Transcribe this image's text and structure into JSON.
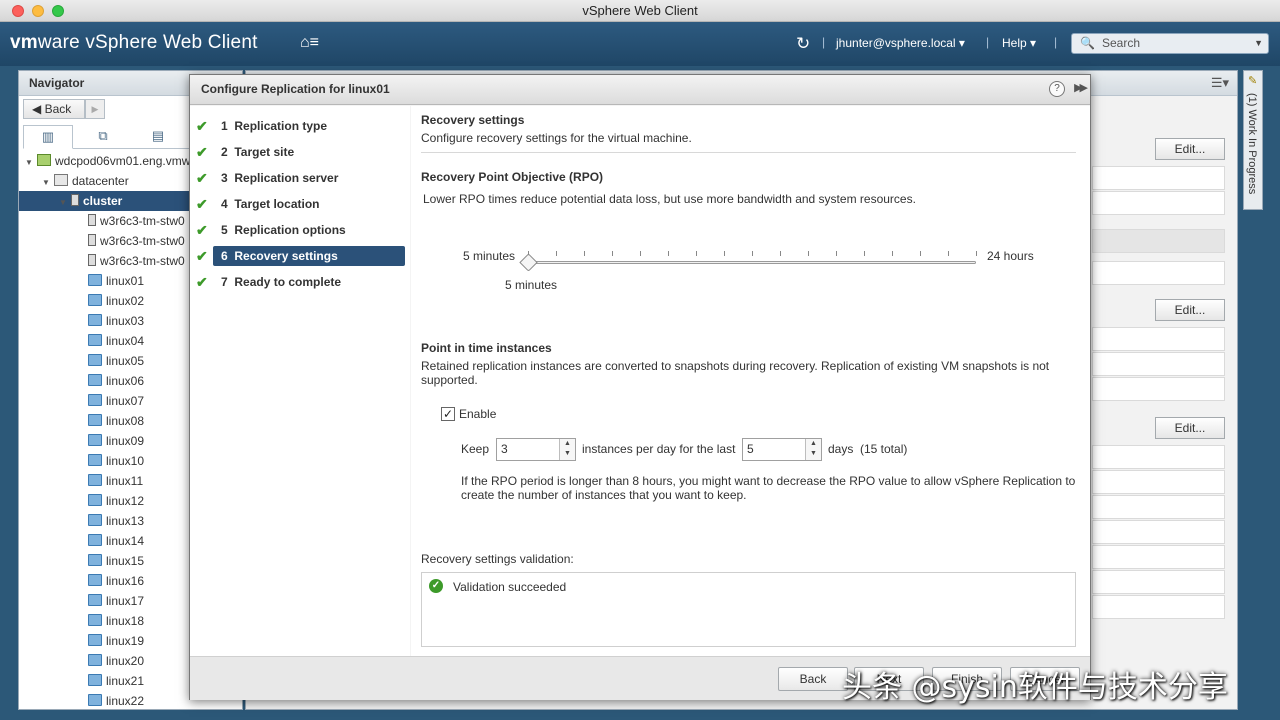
{
  "window": {
    "title": "vSphere Web Client"
  },
  "header": {
    "brand_vm": "vm",
    "brand_ware": "ware",
    "brand_product": " vSphere Web Client",
    "user": "jhunter@vsphere.local",
    "help": "Help",
    "search_placeholder": "Search"
  },
  "navigator": {
    "title": "Navigator",
    "back": "Back",
    "tree": [
      {
        "label": "wdcpod06vm01.eng.vmw",
        "icon": "vcenter-icon",
        "level": 0,
        "expanded": true
      },
      {
        "label": "datacenter",
        "icon": "datacenter-icon",
        "level": 1,
        "expanded": true
      },
      {
        "label": "cluster",
        "icon": "cluster-icon",
        "level": 2,
        "expanded": true,
        "selected": true
      },
      {
        "label": "w3r6c3-tm-stw0",
        "icon": "host-icon",
        "level": 3
      },
      {
        "label": "w3r6c3-tm-stw0",
        "icon": "host-icon",
        "level": 3
      },
      {
        "label": "w3r6c3-tm-stw0",
        "icon": "host-icon",
        "level": 3
      },
      {
        "label": "linux01",
        "icon": "vm-icon",
        "level": 3
      },
      {
        "label": "linux02",
        "icon": "vm-icon",
        "level": 3
      },
      {
        "label": "linux03",
        "icon": "vm-icon",
        "level": 3
      },
      {
        "label": "linux04",
        "icon": "vm-icon",
        "level": 3
      },
      {
        "label": "linux05",
        "icon": "vm-icon",
        "level": 3
      },
      {
        "label": "linux06",
        "icon": "vm-icon",
        "level": 3
      },
      {
        "label": "linux07",
        "icon": "vm-icon",
        "level": 3
      },
      {
        "label": "linux08",
        "icon": "vm-icon",
        "level": 3
      },
      {
        "label": "linux09",
        "icon": "vm-icon",
        "level": 3
      },
      {
        "label": "linux10",
        "icon": "vm-icon",
        "level": 3
      },
      {
        "label": "linux11",
        "icon": "vm-icon",
        "level": 3
      },
      {
        "label": "linux12",
        "icon": "vm-icon",
        "level": 3
      },
      {
        "label": "linux13",
        "icon": "vm-icon",
        "level": 3
      },
      {
        "label": "linux14",
        "icon": "vm-icon",
        "level": 3
      },
      {
        "label": "linux15",
        "icon": "vm-icon",
        "level": 3
      },
      {
        "label": "linux16",
        "icon": "vm-icon",
        "level": 3
      },
      {
        "label": "linux17",
        "icon": "vm-icon",
        "level": 3
      },
      {
        "label": "linux18",
        "icon": "vm-icon",
        "level": 3
      },
      {
        "label": "linux19",
        "icon": "vm-icon",
        "level": 3
      },
      {
        "label": "linux20",
        "icon": "vm-icon",
        "level": 3
      },
      {
        "label": "linux21",
        "icon": "vm-icon",
        "level": 3
      },
      {
        "label": "linux22",
        "icon": "vm-icon",
        "level": 3
      }
    ]
  },
  "main": {
    "edit_label": "Edit..."
  },
  "work_in_progress": {
    "label": "(1) Work In Progress"
  },
  "dialog": {
    "title": "Configure Replication for linux01",
    "steps": [
      {
        "num": "1",
        "label": "Replication type",
        "done": true
      },
      {
        "num": "2",
        "label": "Target site",
        "done": true
      },
      {
        "num": "3",
        "label": "Replication server",
        "done": true
      },
      {
        "num": "4",
        "label": "Target location",
        "done": true
      },
      {
        "num": "5",
        "label": "Replication options",
        "done": true
      },
      {
        "num": "6",
        "label": "Recovery settings",
        "done": true,
        "active": true
      },
      {
        "num": "7",
        "label": "Ready to complete",
        "done": true
      }
    ],
    "recovery": {
      "title": "Recovery settings",
      "subtitle": "Configure recovery settings for the virtual machine."
    },
    "rpo": {
      "title": "Recovery Point Objective (RPO)",
      "description": "Lower RPO times reduce potential data loss, but use more bandwidth and system resources.",
      "min_label": "5 minutes",
      "max_label": "24 hours",
      "value_label": "5 minutes",
      "slider_fraction": 0
    },
    "pit": {
      "title": "Point in time instances",
      "description": "Retained replication instances are converted to snapshots during recovery. Replication of existing VM snapshots is not supported.",
      "enable_label": "Enable",
      "enabled": true,
      "keep_label": "Keep",
      "keep_value": "3",
      "per_day_label": "instances per day for the last",
      "days_value": "5",
      "days_label": "days",
      "total_label": "(15 total)",
      "note": "If the RPO period is longer than 8 hours, you might want to decrease the RPO value to allow vSphere Replication to create the number of instances that you want to keep."
    },
    "validation": {
      "label": "Recovery settings validation:",
      "message": "Validation succeeded"
    },
    "buttons": {
      "back": "Back",
      "next": "Next",
      "finish": "Finish",
      "cancel": "Cancel"
    }
  },
  "watermark": "头条 @sysin软件与技术分享"
}
